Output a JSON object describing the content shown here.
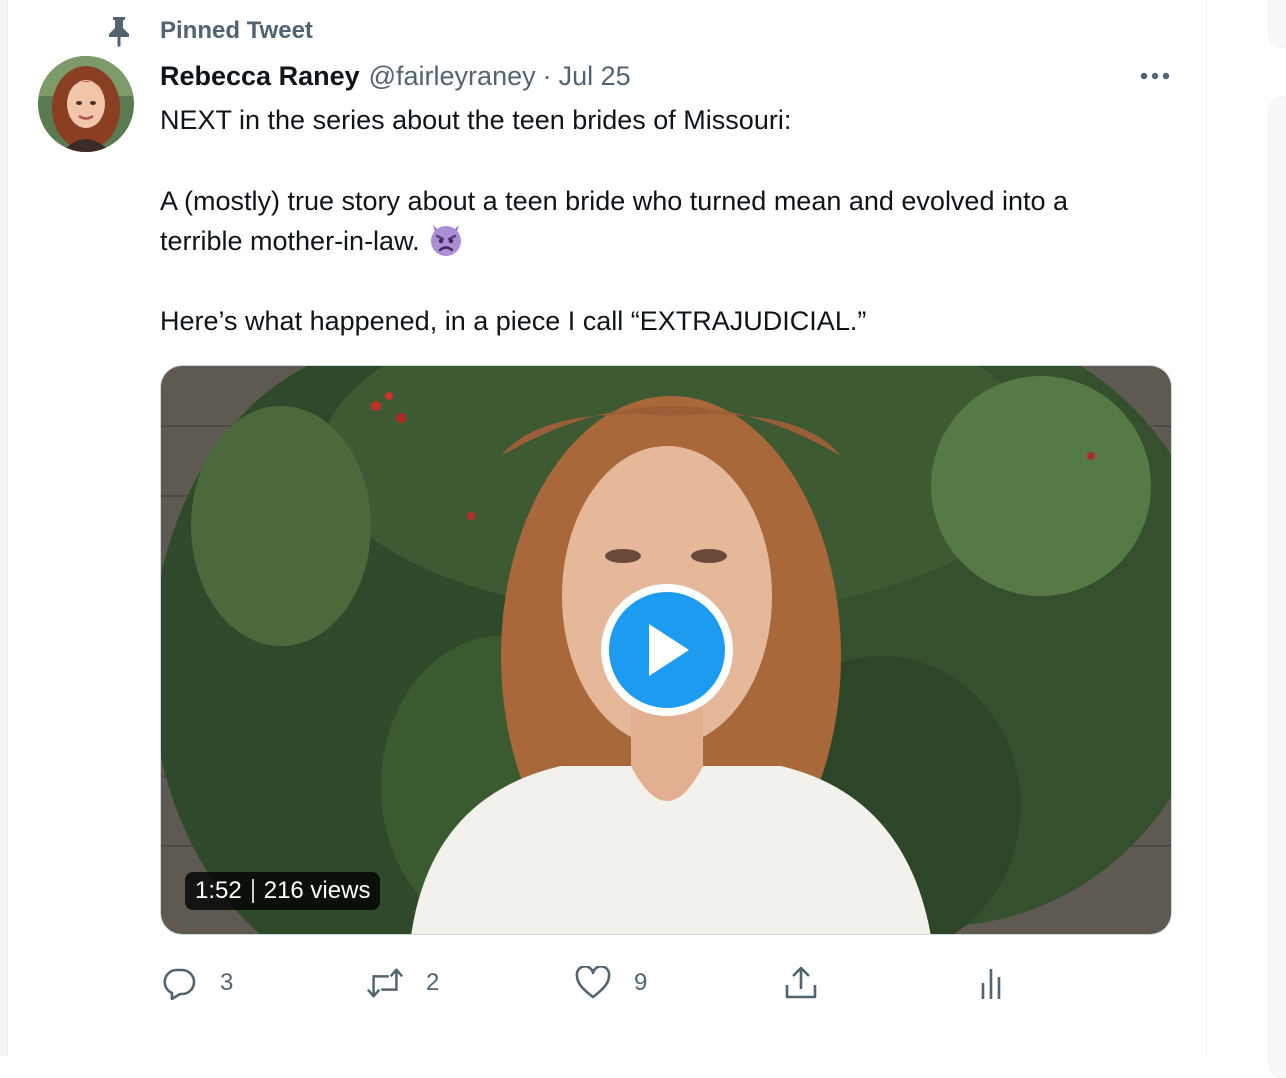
{
  "pinned": {
    "label": "Pinned Tweet",
    "icon": "pin-icon"
  },
  "tweet": {
    "author_name": "Rebecca Raney",
    "handle": "@fairleyraney",
    "separator": "·",
    "date": "Jul 25",
    "text_lines": [
      "NEXT in the series about the teen brides of Missouri:",
      "A (mostly) true story about a teen bride who turned mean and evolved into a",
      "terrible mother-in-law.",
      "Here’s what happened, in a piece I call “EXTRAJUDICIAL.”"
    ],
    "emoji": "angry-devil-emoji"
  },
  "video": {
    "duration": "1:52",
    "views": "216 views",
    "play_icon": "play-icon"
  },
  "actions": {
    "reply_count": "3",
    "retweet_count": "2",
    "like_count": "9",
    "share_icon": "share-icon",
    "analytics_icon": "analytics-icon"
  },
  "colors": {
    "text_primary": "#0f1419",
    "text_secondary": "#536471",
    "accent": "#1d9bf0"
  }
}
